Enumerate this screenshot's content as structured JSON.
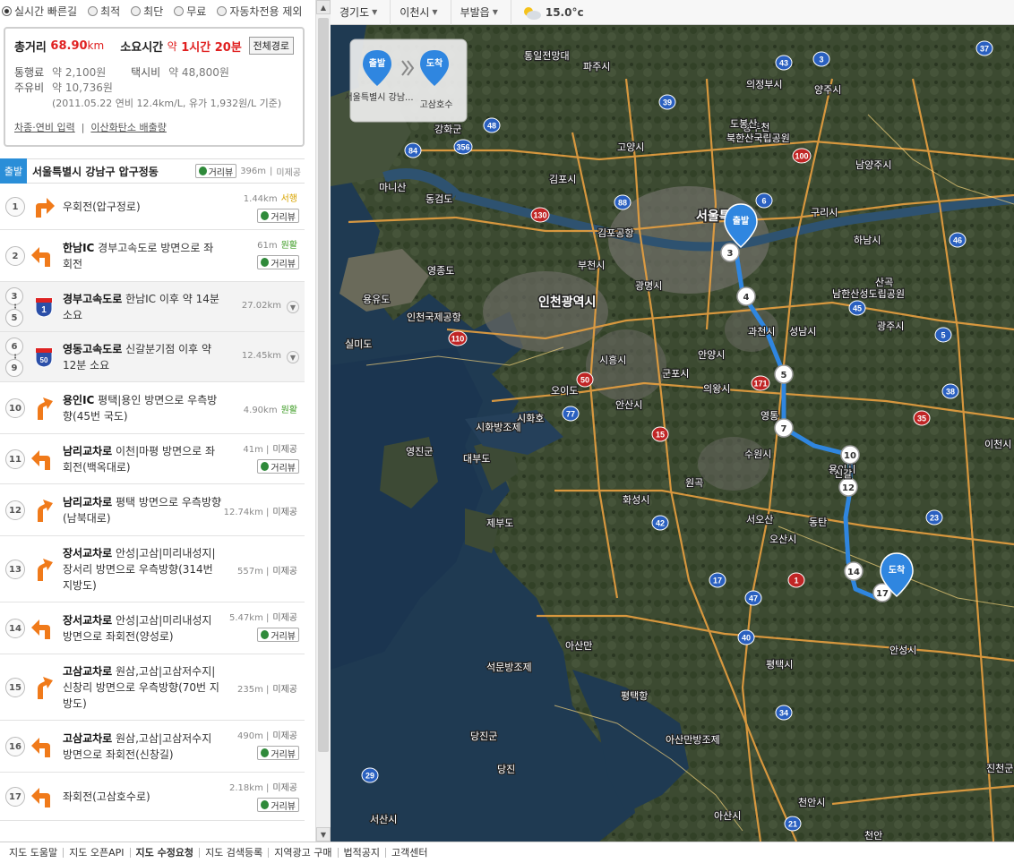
{
  "options": [
    {
      "label": "실시간 빠른길",
      "selected": true
    },
    {
      "label": "최적",
      "selected": false
    },
    {
      "label": "최단",
      "selected": false
    },
    {
      "label": "무료",
      "selected": false
    },
    {
      "label": "자동차전용 제외",
      "selected": false
    }
  ],
  "summary": {
    "distance_label": "총거리",
    "distance_value": "68.90",
    "distance_unit": "km",
    "time_label": "소요시간",
    "time_prefix": "약",
    "time_value": "1시간 20분",
    "full_route_btn": "전체경로",
    "toll_label": "통행료",
    "toll_value": "약 2,100원",
    "taxi_label": "택시비",
    "taxi_value": "약 48,800원",
    "fuel_label": "주유비",
    "fuel_value": "약 10,736원",
    "fuel_note": "(2011.05.22 연비 12.4km/L, 유가 1,932원/L 기준)",
    "link_car": "차종·연비 입력",
    "link_co2": "이산화탄소 배출량"
  },
  "start": {
    "tag": "출발",
    "name": "서울특별시 강남구 압구정동",
    "streetview": "거리뷰",
    "distance": "396m",
    "status": "미제공"
  },
  "steps": [
    {
      "num": "1",
      "desc_bold": "",
      "desc": "우회전(압구정로)",
      "dist": "1.44km",
      "status": "서행",
      "status_class": "yellow",
      "sv": "거리뷰"
    },
    {
      "num": "2",
      "desc_bold": "한남IC",
      "desc": " 경부고속도로 방면으로 좌회전",
      "dist": "61m",
      "status": "원활",
      "status_class": "green",
      "sv": "거리뷰"
    },
    {
      "num": "3",
      "num_end": "5",
      "desc_bold": "경부고속도로",
      "desc": " 한남IC 이후 약 14분 소요",
      "dist": "27.02km",
      "status": "",
      "hwy": "1"
    },
    {
      "num": "6",
      "num_end": "9",
      "desc_bold": "영동고속도로",
      "desc": " 신갈분기점 이후 약 12분 소요",
      "dist": "12.45km",
      "status": "",
      "hwy": "50"
    },
    {
      "num": "10",
      "desc_bold": "용인IC",
      "desc": " 평택|용인 방면으로 우측방향(45번 국도)",
      "dist": "4.90km",
      "status": "원활",
      "status_class": "green"
    },
    {
      "num": "11",
      "desc_bold": "남리교차로",
      "desc": " 이천|마평 방면으로 좌회전(백옥대로)",
      "dist": "41m",
      "status": "미제공",
      "status_class": "gray",
      "sv": "거리뷰"
    },
    {
      "num": "12",
      "desc_bold": "남리교차로",
      "desc": " 평택 방면으로 우측방향(남북대로)",
      "dist": "12.74km",
      "status": "미제공",
      "status_class": "gray"
    },
    {
      "num": "13",
      "desc_bold": "장서교차로",
      "desc": " 안성|고삼|미리내성지|장서리 방면으로 우측방향(314번 지방도)",
      "dist": "557m",
      "status": "미제공",
      "status_class": "gray"
    },
    {
      "num": "14",
      "desc_bold": "장서교차로",
      "desc": " 안성|고삼|미리내성지 방면으로 좌회전(양성로)",
      "dist": "5.47km",
      "status": "미제공",
      "status_class": "gray",
      "sv": "거리뷰"
    },
    {
      "num": "15",
      "desc_bold": "고삼교차로",
      "desc": " 원삼,고삼|고삼저수지|신창리 방면으로 우측방향(70번 지방도)",
      "dist": "235m",
      "status": "미제공",
      "status_class": "gray"
    },
    {
      "num": "16",
      "desc_bold": "고삼교차로",
      "desc": " 원삼,고삼|고삼저수지 방면으로 좌회전(신창길)",
      "dist": "490m",
      "status": "미제공",
      "status_class": "gray",
      "sv": "거리뷰"
    },
    {
      "num": "17",
      "desc_bold": "",
      "desc": "좌회전(고삼호수로)",
      "dist": "2.18km",
      "status": "미제공",
      "status_class": "gray",
      "sv": "거리뷰"
    }
  ],
  "mapbar": {
    "province": "경기도",
    "city": "이천시",
    "town": "부발읍",
    "temperature": "15.0°c"
  },
  "map": {
    "start_marker": "출발",
    "end_marker": "도착",
    "popup_start_label": "서울특별시 강남...",
    "popup_end_label": "고삼호수",
    "popup_start_tag": "출발",
    "popup_end_tag": "도착",
    "route_nodes": [
      "3",
      "4",
      "5",
      "7",
      "10",
      "12",
      "14",
      "17"
    ],
    "place_labels": [
      "통일전망대",
      "파주시",
      "의정부시",
      "양주시",
      "동두천",
      "고양시",
      "남양주시",
      "김포시",
      "서울특별시",
      "구리시",
      "하남시",
      "김포공항",
      "부천시",
      "광명시",
      "인천광역시",
      "인천국제공항",
      "영종도",
      "용유도",
      "실미도",
      "시흥시",
      "안양시",
      "과천시",
      "성남시",
      "광주시",
      "군포시",
      "의왕시",
      "안산시",
      "오이도",
      "시화호",
      "시화방조제",
      "대부도",
      "영진군",
      "수원시",
      "용인시",
      "화성시",
      "제부도",
      "오산시",
      "서오산",
      "평택시",
      "안성시",
      "평택항",
      "아산만",
      "석문방조제",
      "아산만방조제",
      "당진군",
      "당진",
      "천안시",
      "아산시",
      "서산시",
      "진천군",
      "이천시",
      "강화군",
      "북한산국립공원",
      "도봉산",
      "남한산성도립공원",
      "마니산",
      "동검도",
      "신갈",
      "산곡",
      "동탄",
      "원곡",
      "천안",
      "영통"
    ],
    "road_shields": [
      "37",
      "43",
      "3",
      "48",
      "39",
      "356",
      "84",
      "100",
      "6",
      "130",
      "88",
      "45",
      "1",
      "110",
      "42",
      "50",
      "15",
      "171",
      "77",
      "17",
      "40",
      "34",
      "38",
      "35",
      "29",
      "21",
      "5",
      "46",
      "47",
      "23"
    ]
  },
  "footer": [
    {
      "label": "지도 도움말",
      "bold": false
    },
    {
      "label": "지도 오픈API",
      "bold": false
    },
    {
      "label": "지도 수정요청",
      "bold": true
    },
    {
      "label": "지도 검색등록",
      "bold": false
    },
    {
      "label": "지역광고 구매",
      "bold": false
    },
    {
      "label": "법적공지",
      "bold": false
    },
    {
      "label": "고객센터",
      "bold": false
    }
  ],
  "colors": {
    "route": "#2f86e0",
    "accent_red": "#e02020",
    "start_tag": "#2a8ed8",
    "arrow": "#f07a1a"
  }
}
